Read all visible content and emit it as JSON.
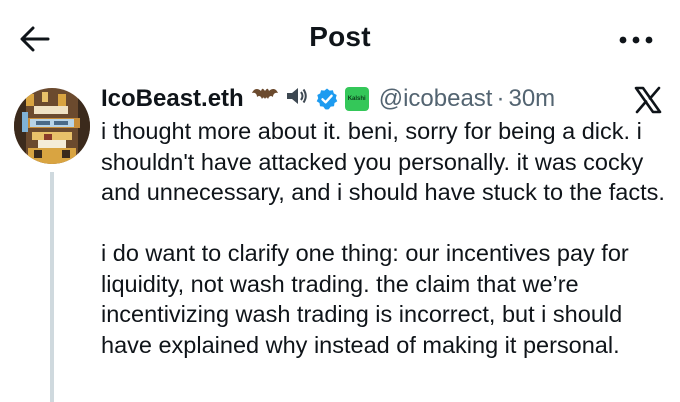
{
  "header": {
    "title": "Post",
    "back_icon": "arrow-left-icon",
    "more_icon": "more-horizontal-icon"
  },
  "post": {
    "display_name": "IcoBeast.eth",
    "badges": [
      "bat-emoji",
      "speaker-emoji",
      "verified-icon",
      "kalshi-affiliate-badge"
    ],
    "affiliate_label": "Kalshi",
    "handle": "@icobeast",
    "separator": "·",
    "time": "30m",
    "platform_icon": "x-logo-icon",
    "body_paragraphs": [
      "i thought more about it. beni, sorry for being a dick. i shouldn't have attacked you personally. it was cocky and unnecessary, and i should have stuck to the facts.",
      "i do want to clarify one thing: our incentives pay for liquidity, not wash trading. the claim that we’re incentivizing wash trading is incorrect, but i should have explained why instead of making it personal."
    ]
  },
  "colors": {
    "text": "#0f1419",
    "secondary": "#536471",
    "verified": "#1d9bf0",
    "affiliate": "#34c759",
    "thread_line": "#cfd9de"
  }
}
